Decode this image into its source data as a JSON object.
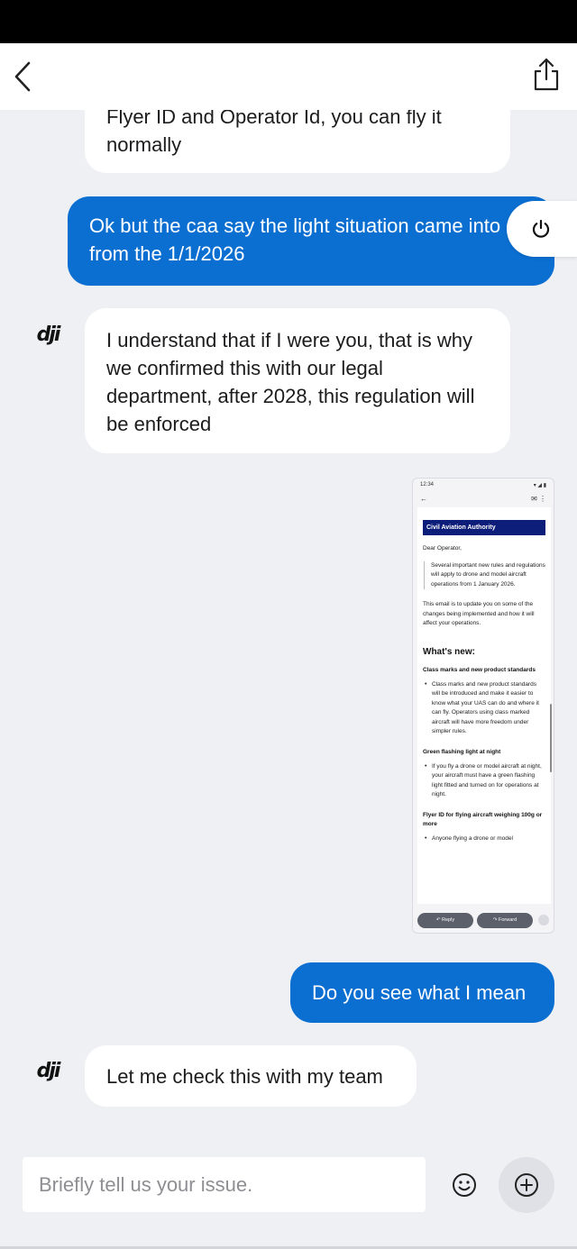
{
  "messages": [
    {
      "id": "m1",
      "from": "agent",
      "text": "Flyer ID and Operator Id, you can fly it normally"
    },
    {
      "id": "m2",
      "from": "user",
      "text": "Ok but the caa say the light situation came into effect from the 1/1/2026"
    },
    {
      "id": "m3",
      "from": "agent",
      "text": "I understand that if I were you, that is why we confirmed this with our legal department, after 2028, this regulation will be enforced"
    },
    {
      "id": "m5",
      "from": "user",
      "text": "Do you see what I mean"
    },
    {
      "id": "m6",
      "from": "agent",
      "text": "Let me check this with my team"
    }
  ],
  "agent": {
    "logo_text": "dji"
  },
  "attachment": {
    "status_time": "12:34",
    "header": "Civil Aviation Authority",
    "greeting": "Dear Operator,",
    "intro_quote": "Several important new rules and regulations will apply to drone and model aircraft operations from 1 January 2026.",
    "intro_body": "This email is to update you on some of the changes being implemented and how it will affect your operations.",
    "heading": "What's new:",
    "sections": [
      {
        "title": "Class marks and new product standards",
        "bullet": "Class marks and new product standards will be introduced and make it easier to know what your UAS can do and where it can fly. Operators using class marked aircraft will have more freedom under simpler rules."
      },
      {
        "title": "Green flashing light at night",
        "bullet": "If you fly a drone or model aircraft at night, your aircraft must have a green flashing light fitted and turned on for operations at night."
      },
      {
        "title": "Flyer ID for flying aircraft weighing 100g or more",
        "bullet": "Anyone flying a drone or model"
      }
    ],
    "reply_label": "Reply",
    "forward_label": "Forward"
  },
  "composer": {
    "placeholder": "Briefly tell us your issue.",
    "value": ""
  },
  "icons": {
    "back": "chevron-left-icon",
    "share": "share-icon",
    "power": "power-icon",
    "emoji": "smiley-icon",
    "add": "plus-circle-icon"
  },
  "colors": {
    "user_bubble": "#0b6fd2",
    "agent_bubble": "#ffffff",
    "background": "#eef0f4",
    "caa_header": "#0c1d7a"
  }
}
